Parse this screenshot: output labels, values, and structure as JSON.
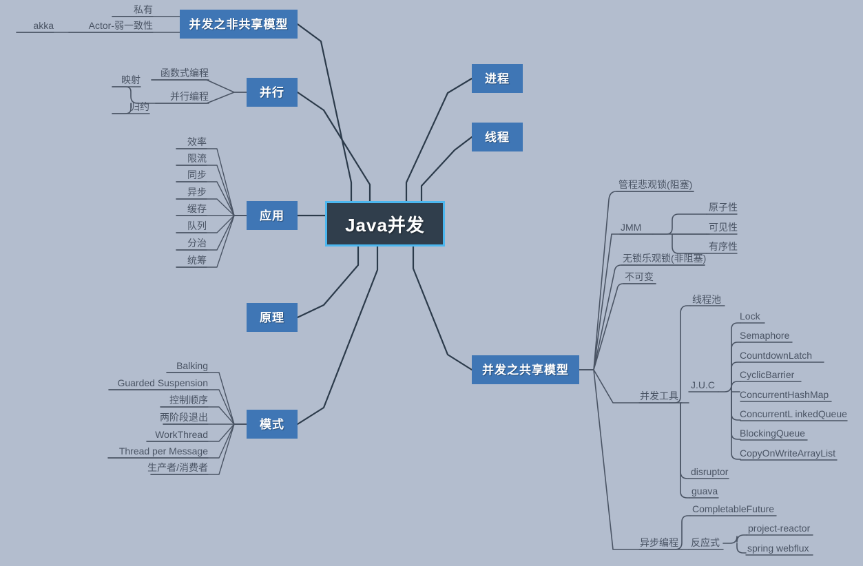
{
  "diagram": {
    "title": "Java并发",
    "type": "mind-map",
    "background_color": "#b3bdce",
    "accent_color": "#3f76b5",
    "root_fill": "#303e4c",
    "root_border": "#4cb7ef",
    "text_color": "#4a5464",
    "wire_color": "#2b3a4a"
  },
  "root": {
    "label": "Java并发"
  },
  "topics": {
    "non_shared_model": {
      "label": "并发之非共享模型"
    },
    "parallel": {
      "label": "并行"
    },
    "application": {
      "label": "应用"
    },
    "principle": {
      "label": "原理"
    },
    "pattern": {
      "label": "模式"
    },
    "process": {
      "label": "进程"
    },
    "thread": {
      "label": "线程"
    },
    "shared_model": {
      "label": "并发之共享模型"
    }
  },
  "non_shared_children": [
    {
      "label": "私有"
    },
    {
      "label": "Actor-弱一致性"
    }
  ],
  "actor_children": [
    {
      "label": "akka"
    }
  ],
  "parallel_children": [
    {
      "label": "函数式编程"
    },
    {
      "label": "并行编程"
    }
  ],
  "parallel_programming_children": [
    {
      "label": "映射"
    },
    {
      "label": "归约"
    }
  ],
  "application_children": [
    {
      "label": "效率"
    },
    {
      "label": "限流"
    },
    {
      "label": "同步"
    },
    {
      "label": "异步"
    },
    {
      "label": "缓存"
    },
    {
      "label": "队列"
    },
    {
      "label": "分治"
    },
    {
      "label": "统筹"
    }
  ],
  "pattern_children": [
    {
      "label": "Balking"
    },
    {
      "label": "Guarded Suspension"
    },
    {
      "label": "控制顺序"
    },
    {
      "label": "两阶段退出"
    },
    {
      "label": "WorkThread"
    },
    {
      "label": "Thread per Message"
    },
    {
      "label": "生产者/消费者"
    }
  ],
  "shared_children": [
    {
      "label": "管程悲观锁(阻塞)"
    },
    {
      "label": "JMM"
    },
    {
      "label": "无锁乐观锁(非阻塞)"
    },
    {
      "label": "不可变"
    },
    {
      "label": "并发工具"
    },
    {
      "label": "异步编程"
    }
  ],
  "jmm_children": [
    {
      "label": "原子性"
    },
    {
      "label": "可见性"
    },
    {
      "label": "有序性"
    }
  ],
  "tools_children": [
    {
      "label": "线程池"
    },
    {
      "label": "J.U.C"
    },
    {
      "label": "disruptor"
    },
    {
      "label": "guava"
    }
  ],
  "juc_children": [
    {
      "label": "Lock"
    },
    {
      "label": "Semaphore"
    },
    {
      "label": "CountdownLatch"
    },
    {
      "label": "CyclicBarrier"
    },
    {
      "label": "ConcurrentHashMap"
    },
    {
      "label": "ConcurrentL inkedQueue"
    },
    {
      "label": "BlockingQueue"
    },
    {
      "label": "CopyOnWriteArrayList"
    }
  ],
  "async_children": [
    {
      "label": "CompletableFuture"
    },
    {
      "label": "反应式"
    }
  ],
  "reactive_children": [
    {
      "label": "project-reactor"
    },
    {
      "label": "spring webflux"
    }
  ]
}
